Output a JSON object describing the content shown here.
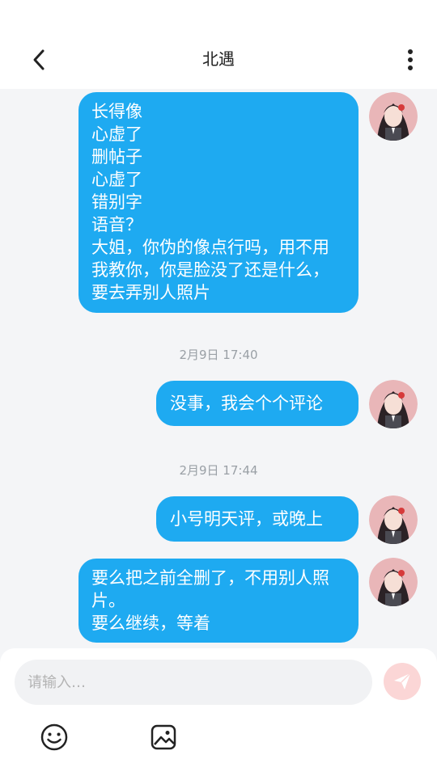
{
  "header": {
    "title": "北遇"
  },
  "messages": [
    {
      "type": "outgoing",
      "text": "长得像\n心虚了\n删帖子\n心虚了\n错别字\n语音？\n大姐，你伪的像点行吗，用不用我教你，你是脸没了还是什么，要去弄别人照片"
    },
    {
      "type": "timestamp",
      "text": "2月9日 17:40"
    },
    {
      "type": "outgoing",
      "text": "没事，我会个个评论"
    },
    {
      "type": "timestamp",
      "text": "2月9日 17:44"
    },
    {
      "type": "outgoing",
      "text": "小号明天评，或晚上"
    },
    {
      "type": "outgoing",
      "text": "要么把之前全删了，不用别人照片。\n要么继续，等着"
    }
  ],
  "composer": {
    "placeholder": "请输入…"
  },
  "icons": {
    "back": "back-arrow-icon",
    "more": "more-vertical-icon",
    "send": "paper-plane-icon",
    "emoji": "emoji-icon",
    "image": "image-icon"
  },
  "colors": {
    "bubble": "#1eaaf1",
    "send_button": "#fbd6d6",
    "send_icon": "#ffffff"
  }
}
